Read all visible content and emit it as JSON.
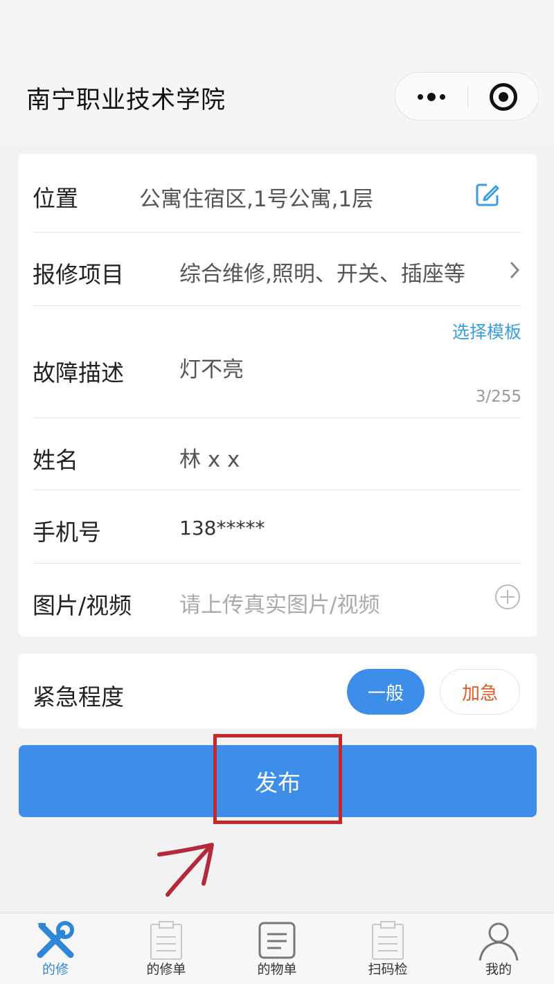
{
  "header": {
    "title": "南宁职业技术学院",
    "more_icon": "more-dots-icon",
    "close_icon": "close-target-icon"
  },
  "form": {
    "location": {
      "label": "位置",
      "value": "公寓住宿区,1号公寓,1层",
      "icon": "edit-icon"
    },
    "item": {
      "label": "报修项目",
      "value": "综合维修,照明、开关、插座等",
      "icon": "chevron-right-icon"
    },
    "description": {
      "label": "故障描述",
      "value": "灯不亮",
      "template_link": "选择模板",
      "counter": "3/255"
    },
    "name": {
      "label": "姓名",
      "value": "林 x  x"
    },
    "phone": {
      "label": "手机号",
      "value": "138*****"
    },
    "media": {
      "label": "图片/视频",
      "placeholder": "请上传真实图片/视频",
      "icon": "plus-circle-icon"
    }
  },
  "urgency": {
    "label": "紧急程度",
    "options": [
      "一般",
      "加急"
    ],
    "selected": "一般"
  },
  "publish": {
    "label": "发布"
  },
  "tabbar": {
    "items": [
      {
        "label": "的修",
        "icon": "tools-icon",
        "active": true
      },
      {
        "label": "的修单",
        "icon": "clipboard-icon",
        "active": false
      },
      {
        "label": "的物单",
        "icon": "document-icon",
        "active": false
      },
      {
        "label": "扫码检",
        "icon": "clipboard-check-icon",
        "active": false
      },
      {
        "label": "我的",
        "icon": "user-icon",
        "active": false
      }
    ]
  },
  "colors": {
    "primary": "#3d8ee9",
    "link": "#3a9ee0",
    "urgent": "#e05a2a",
    "annotation": "#c62828"
  }
}
